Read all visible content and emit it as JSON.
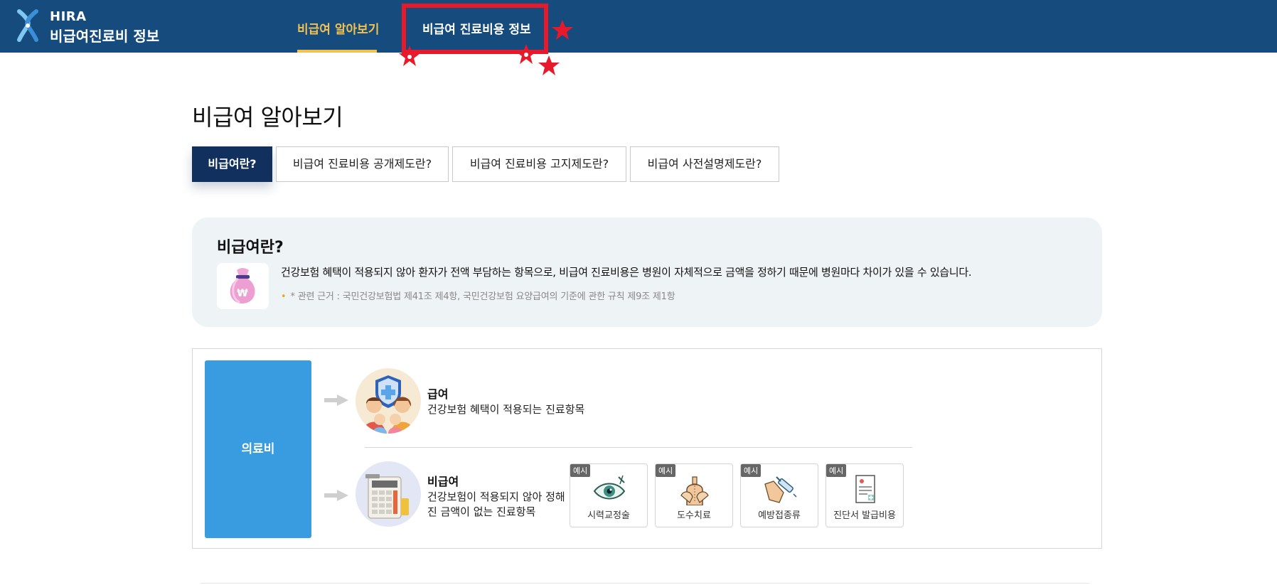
{
  "header": {
    "logo_line1": "HIRA",
    "logo_line2": "비급여진료비 정보",
    "nav": [
      {
        "label": "비급여 알아보기",
        "active": true
      },
      {
        "label": "비급여 진료비용 정보",
        "active": false
      }
    ]
  },
  "colors": {
    "header_bg": "#164b7e",
    "accent_yellow": "#f2c14e",
    "active_tab": "#12305e",
    "medical_box": "#3a9ce0",
    "annotation_red": "#e8192a"
  },
  "page_title": "비급여 알아보기",
  "tabs": [
    {
      "label": "비급여란?",
      "active": true
    },
    {
      "label": "비급여 진료비용 공개제도란?",
      "active": false
    },
    {
      "label": "비급여 진료비용 고지제도란?",
      "active": false
    },
    {
      "label": "비급여 사전설명제도란?",
      "active": false
    }
  ],
  "info": {
    "title": "비급여란?",
    "icon": "money-bag-won-icon",
    "text": "건강보험 혜택이 적용되지 않아 환자가 전액 부담하는 항목으로, 비급여 진료비용은 병원이 자체적으로 금액을 정하기 때문에 병원마다 차이가 있을 수 있습니다.",
    "note": "* 관련 근거 : 국민건강보험법 제41조 제4항, 국민건강보험 요양급여의 기준에 관한 규칙 제9조 제1항"
  },
  "diagram": {
    "medical_label": "의료비",
    "covered": {
      "title": "급여",
      "desc": "건강보험 혜택이 적용되는 진료항목",
      "icon": "family-shield-icon"
    },
    "noncovered": {
      "title": "비급여",
      "desc": "건강보험이 적용되지 않아 정해진 금액이 없는 진료항목",
      "icon": "calculator-icon"
    },
    "examples": [
      {
        "badge": "예시",
        "label": "시력교정술",
        "icon": "eye-icon"
      },
      {
        "badge": "예시",
        "label": "도수치료",
        "icon": "manual-therapy-icon"
      },
      {
        "badge": "예시",
        "label": "예방접종류",
        "icon": "syringe-icon"
      },
      {
        "badge": "예시",
        "label": "진단서 발급비용",
        "icon": "certificate-icon"
      }
    ]
  }
}
